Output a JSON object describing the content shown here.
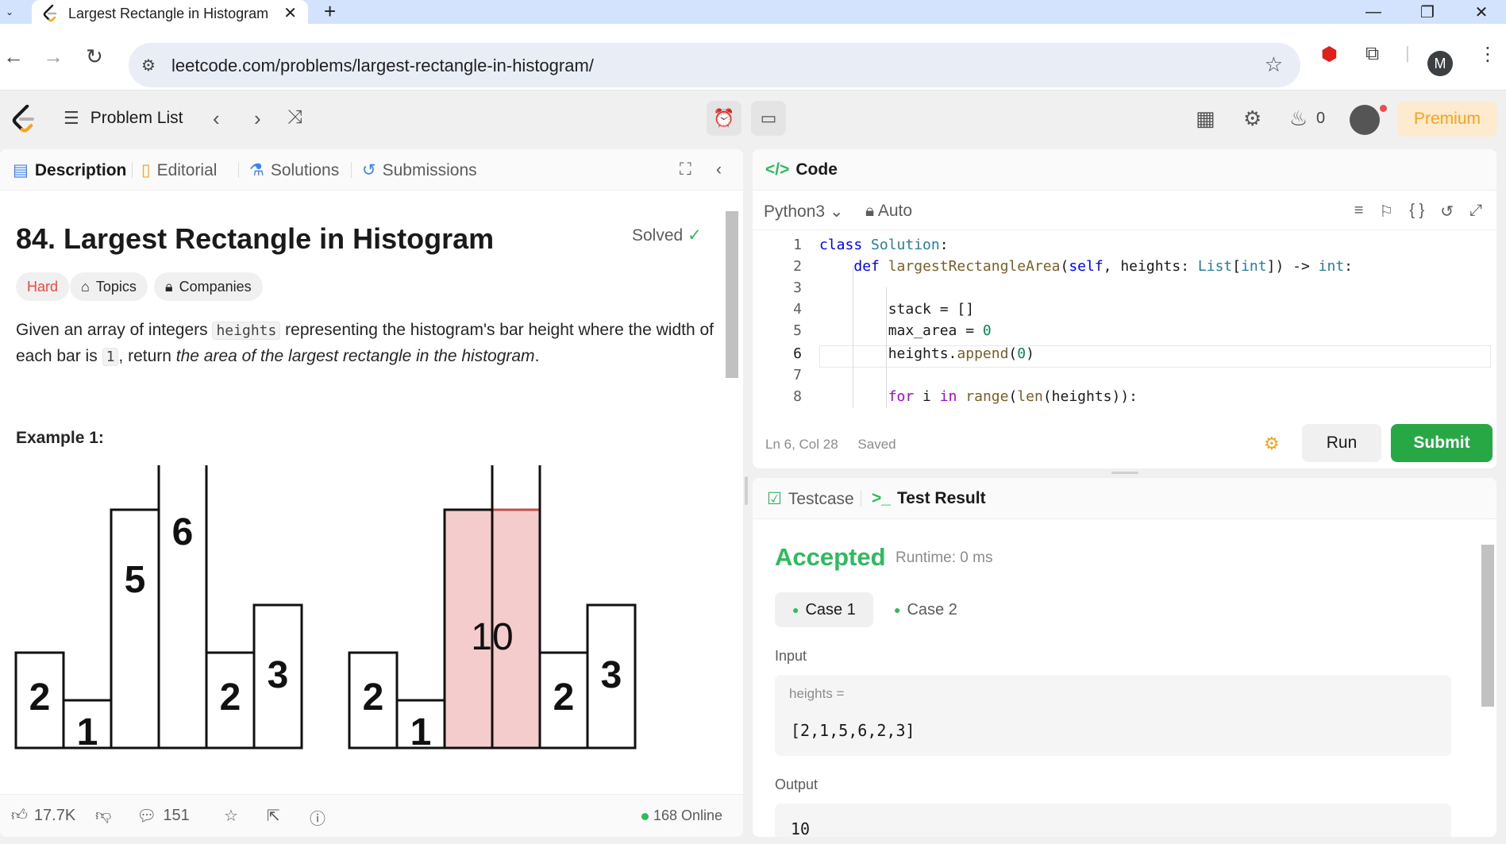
{
  "browser": {
    "tab_title": "Largest Rectangle in Histogram",
    "url": "leetcode.com/problems/largest-rectangle-in-histogram/",
    "profile_initial": "M"
  },
  "nav": {
    "problem_list": "Problem List",
    "streak": "0",
    "premium": "Premium"
  },
  "left": {
    "tabs": [
      "Description",
      "Editorial",
      "Solutions",
      "Submissions"
    ],
    "title": "84. Largest Rectangle in Histogram",
    "solved": "Solved",
    "difficulty": "Hard",
    "topics": "Topics",
    "companies": "Companies",
    "desc_1": "Given an array of integers ",
    "desc_code1": "heights",
    "desc_2": " representing the histogram's bar height where the width of each bar is ",
    "desc_code2": "1",
    "desc_3": ", return ",
    "desc_em": "the area of the largest rectangle in the histogram",
    "desc_4": ".",
    "example_heading": "Example 1:",
    "histogram_left": {
      "heights": [
        2,
        1,
        5,
        6,
        2,
        3
      ],
      "labels": [
        "2",
        "1",
        "5",
        "6",
        "2",
        "3"
      ]
    },
    "histogram_right": {
      "heights": [
        2,
        1,
        5,
        6,
        2,
        3
      ],
      "labels": [
        "2",
        "1",
        "10",
        "2",
        "3"
      ],
      "highlight_bars": [
        2,
        3
      ],
      "highlight_label": "10"
    },
    "likes": "17.7K",
    "comments": "151",
    "online": "168 Online"
  },
  "code": {
    "tab": "Code",
    "language": "Python3",
    "auto": "Auto",
    "status_pos": "Ln 6, Col 28",
    "status_saved": "Saved",
    "run": "Run",
    "submit": "Submit",
    "line_numbers": [
      "1",
      "2",
      "3",
      "4",
      "5",
      "6",
      "7",
      "8"
    ]
  },
  "test": {
    "tabs": [
      "Testcase",
      "Test Result"
    ],
    "result": "Accepted",
    "runtime": "Runtime: 0 ms",
    "cases": [
      "Case 1",
      "Case 2"
    ],
    "input_label": "Input",
    "var_name": "heights =",
    "input_value": "[2,1,5,6,2,3]",
    "output_label": "Output",
    "output_value": "10"
  },
  "colors": {
    "accent_orange": "#ffa116",
    "accepted_green": "#2cbb5d",
    "submit_green": "#28a745",
    "hard_red": "#ef4743",
    "highlight_fill": "#f4cccc",
    "highlight_stroke": "#c0504d"
  }
}
